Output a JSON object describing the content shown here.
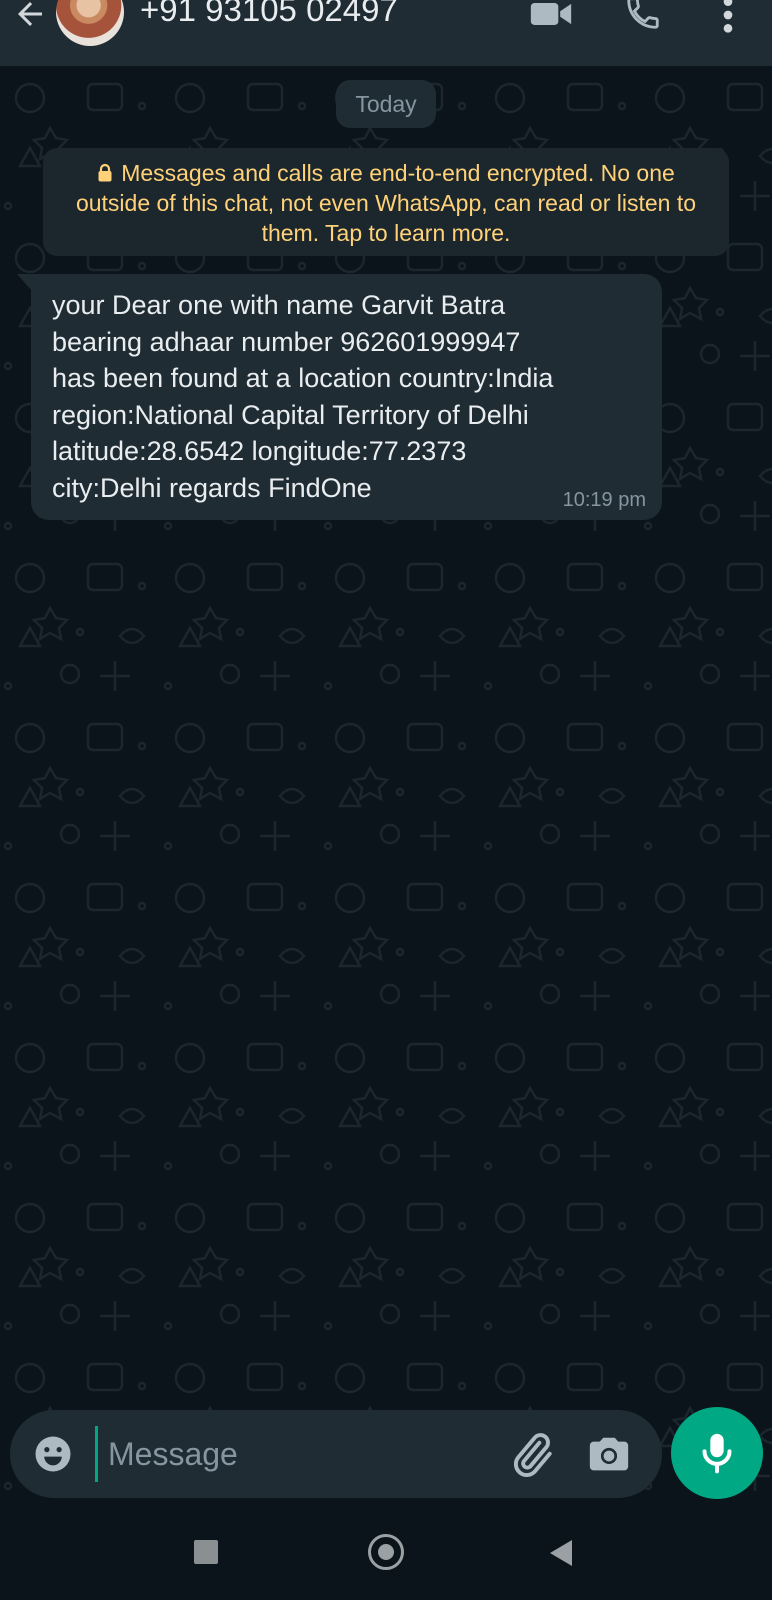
{
  "header": {
    "contact_name": "+91 93105 02497"
  },
  "chat": {
    "date_chip": "Today",
    "encryption_notice": "Messages and calls are end-to-end encrypted. No one outside of this chat, not even WhatsApp, can read or listen to them. Tap to learn more.",
    "messages": [
      {
        "text": "your Dear one with name Garvit Batra\nbearing adhaar number 962601999947\nhas been found at a location country:India\nregion:National Capital Territory of Delhi\nlatitude:28.6542 longitude:77.2373\ncity:Delhi regards FindOne",
        "time": "10:19 pm",
        "direction": "incoming"
      }
    ]
  },
  "composer": {
    "placeholder": "Message"
  },
  "icons": {
    "back": "arrow-left-icon",
    "video": "video-camera-icon",
    "call": "phone-icon",
    "more": "more-vertical-icon",
    "lock": "lock-icon",
    "emoji": "emoji-icon",
    "attach": "paperclip-icon",
    "camera": "camera-icon",
    "mic": "microphone-icon"
  },
  "colors": {
    "header_bg": "#1f2c34",
    "chat_bg": "#0b141a",
    "bubble_bg": "#1f2c34",
    "notice_text": "#ffd279",
    "accent": "#00a884",
    "secondary_text": "#8696a0",
    "primary_text": "#e9edef"
  }
}
